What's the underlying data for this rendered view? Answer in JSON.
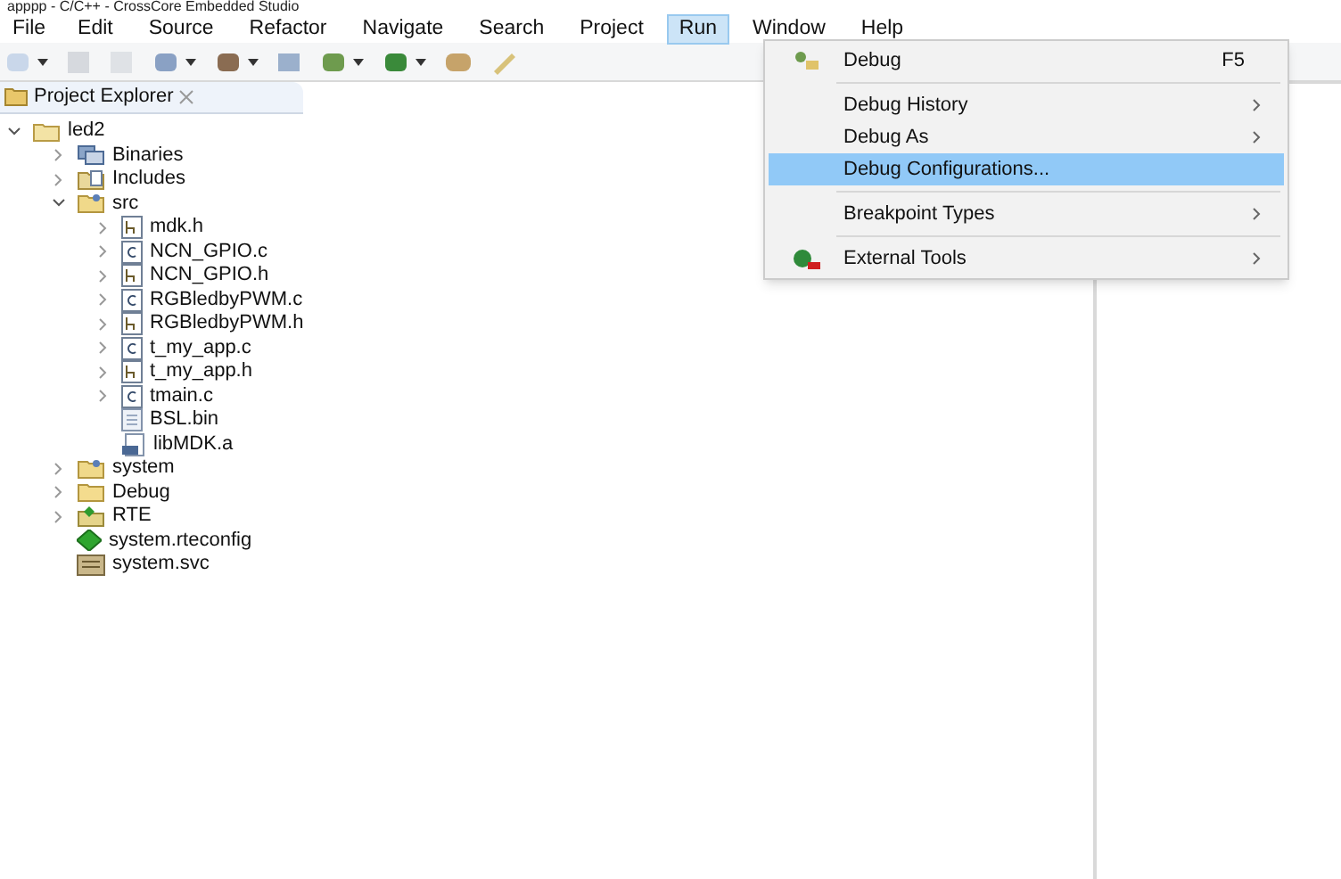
{
  "window": {
    "title": "apppp - C/C++ - CrossCore Embedded Studio"
  },
  "menu_bar": [
    {
      "label": "File",
      "selected": false
    },
    {
      "label": "Edit",
      "selected": false
    },
    {
      "label": "Source",
      "selected": false
    },
    {
      "label": "Refactor",
      "selected": false
    },
    {
      "label": "Navigate",
      "selected": false
    },
    {
      "label": "Search",
      "selected": false
    },
    {
      "label": "Project",
      "selected": false
    },
    {
      "label": "Run",
      "selected": true
    },
    {
      "label": "Window",
      "selected": false
    },
    {
      "label": "Help",
      "selected": false
    }
  ],
  "project_explorer": {
    "title": "Project Explorer",
    "tree": [
      {
        "label": "led2",
        "kind": "project",
        "expanded": true,
        "children": [
          {
            "label": "Binaries",
            "kind": "binaries",
            "expanded": false
          },
          {
            "label": "Includes",
            "kind": "includes",
            "expanded": false
          },
          {
            "label": "src",
            "kind": "folder",
            "expanded": true,
            "children": [
              {
                "label": "mdk.h",
                "kind": "header",
                "expanded": false
              },
              {
                "label": "NCN_GPIO.c",
                "kind": "source",
                "expanded": false
              },
              {
                "label": "NCN_GPIO.h",
                "kind": "header",
                "expanded": false
              },
              {
                "label": "RGBledbyPWM.c",
                "kind": "source",
                "expanded": false
              },
              {
                "label": "RGBledbyPWM.h",
                "kind": "header",
                "expanded": false
              },
              {
                "label": "t_my_app.c",
                "kind": "source",
                "expanded": false
              },
              {
                "label": "t_my_app.h",
                "kind": "header",
                "expanded": false
              },
              {
                "label": "tmain.c",
                "kind": "source",
                "expanded": false
              },
              {
                "label": "BSL.bin",
                "kind": "binary"
              },
              {
                "label": "libMDK.a",
                "kind": "archive"
              }
            ]
          },
          {
            "label": "system",
            "kind": "folder",
            "expanded": false
          },
          {
            "label": "Debug",
            "kind": "plain-folder",
            "expanded": false
          },
          {
            "label": "RTE",
            "kind": "rte",
            "expanded": false
          },
          {
            "label": "system.rteconfig",
            "kind": "rteconfig"
          },
          {
            "label": "system.svc",
            "kind": "svc"
          }
        ]
      }
    ]
  },
  "run_menu": [
    {
      "kind": "launch-item",
      "label": "Debug",
      "shortcut": "F5",
      "selected": false
    },
    {
      "kind": "separator"
    },
    {
      "kind": "item",
      "label": "Debug History",
      "submenu": true,
      "selected": false
    },
    {
      "kind": "item",
      "label": "Debug As",
      "submenu": true,
      "selected": false
    },
    {
      "kind": "item",
      "label": "Debug Configurations...",
      "selected": true
    },
    {
      "kind": "separator"
    },
    {
      "kind": "item",
      "label": "Breakpoint Types",
      "submenu": true,
      "selected": false
    },
    {
      "kind": "separator"
    },
    {
      "kind": "tool-item",
      "label": "External Tools",
      "submenu": true,
      "selected": false
    }
  ]
}
